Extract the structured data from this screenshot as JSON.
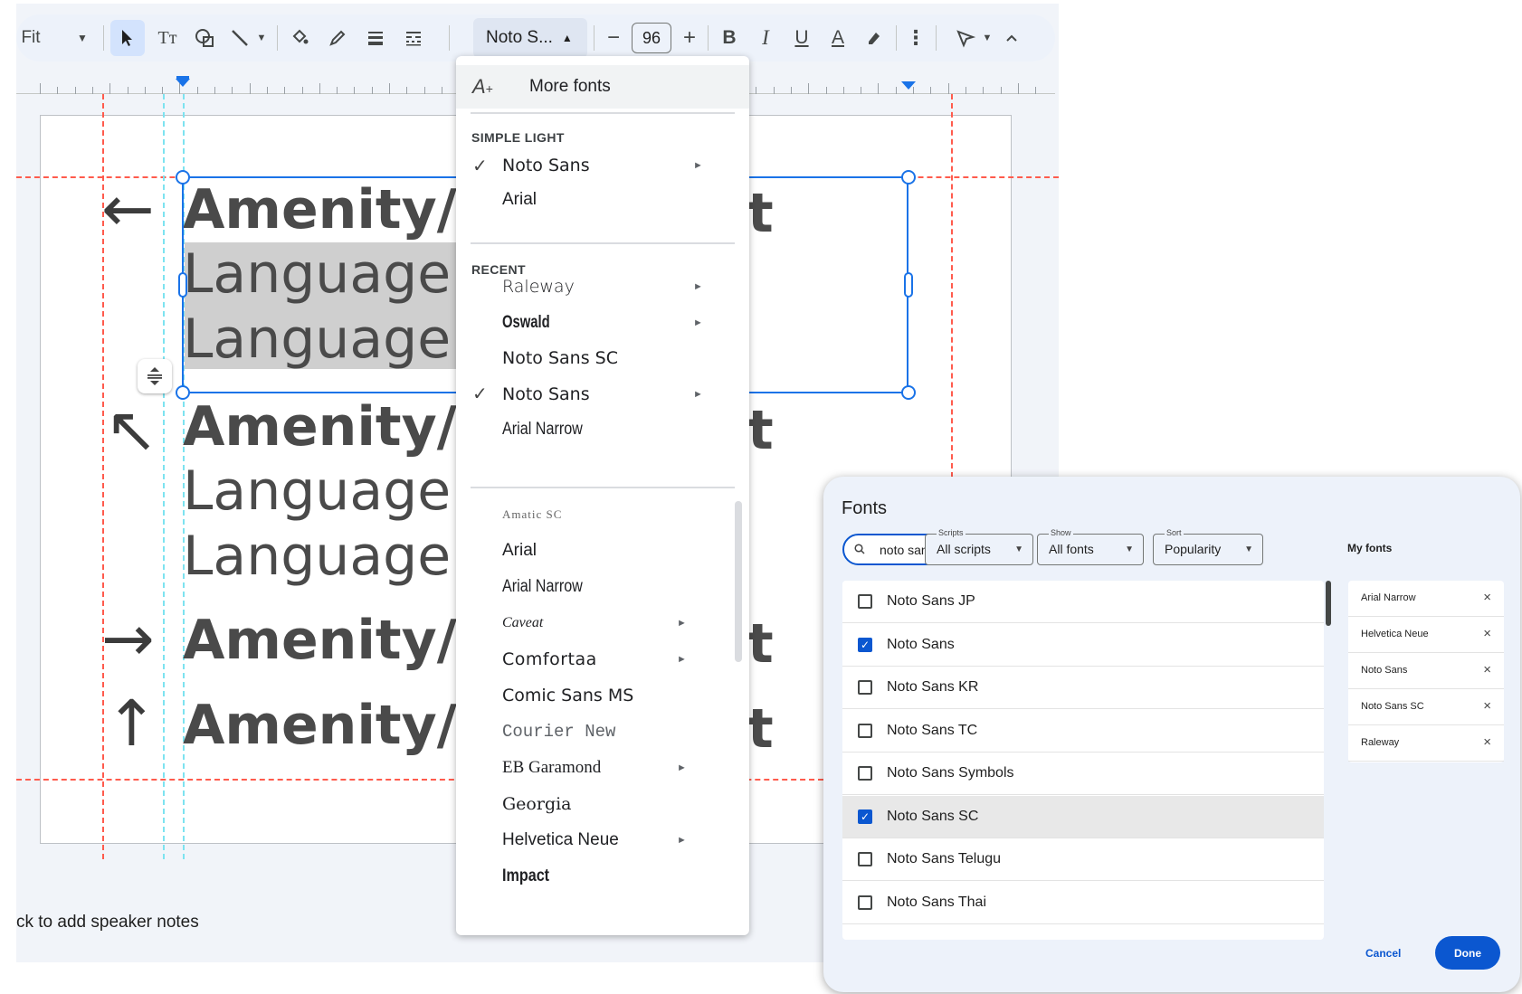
{
  "toolbar": {
    "zoom_label": "Fit",
    "font_name": "Noto S...",
    "font_size": "96",
    "icons": [
      "select-arrow-icon",
      "text-box-icon",
      "shape-icon",
      "line-icon",
      "fill-color-icon",
      "border-color-icon",
      "border-weight-icon",
      "border-dash-icon",
      "bold-icon",
      "italic-icon",
      "underline-icon",
      "text-color-icon",
      "highlight-icon",
      "more-icon",
      "pointer-icon",
      "collapse-icon"
    ],
    "bold": "B",
    "italic": "I",
    "underline": "U",
    "text_color": "A",
    "minus": "−",
    "plus": "+"
  },
  "slide": {
    "text_bold": "Amenity/D",
    "text_regular": "Language",
    "cut_char": "t"
  },
  "speaker_notes": "ck to add speaker notes",
  "font_menu": {
    "more_fonts": "More fonts",
    "section_simple": "SIMPLE LIGHT",
    "simple_items": [
      {
        "name": "Noto Sans",
        "checked": true,
        "submenu": true
      },
      {
        "name": "Arial",
        "checked": false,
        "submenu": false
      }
    ],
    "section_recent": "RECENT",
    "recent_items": [
      {
        "name": "Raleway",
        "checked": false,
        "submenu": true
      },
      {
        "name": "Oswald",
        "checked": false,
        "submenu": true
      },
      {
        "name": "Noto Sans SC",
        "checked": false,
        "submenu": false
      },
      {
        "name": "Noto Sans",
        "checked": true,
        "submenu": true
      },
      {
        "name": "Arial Narrow",
        "checked": false,
        "submenu": false
      }
    ],
    "all_items": [
      {
        "name": "Amatic SC",
        "submenu": false
      },
      {
        "name": "Arial",
        "submenu": false
      },
      {
        "name": "Arial Narrow",
        "submenu": false
      },
      {
        "name": "Caveat",
        "submenu": true
      },
      {
        "name": "Comfortaa",
        "submenu": true
      },
      {
        "name": "Comic Sans MS",
        "submenu": false
      },
      {
        "name": "Courier New",
        "submenu": false
      },
      {
        "name": "EB Garamond",
        "submenu": true
      },
      {
        "name": "Georgia",
        "submenu": false
      },
      {
        "name": "Helvetica Neue",
        "submenu": true
      },
      {
        "name": "Impact",
        "submenu": false
      }
    ],
    "check_glyph": "✓",
    "submenu_glyph": "►"
  },
  "fonts_dialog": {
    "title": "Fonts",
    "search_value": "noto sans",
    "filters": [
      {
        "label": "Scripts",
        "value": "All scripts"
      },
      {
        "label": "Show",
        "value": "All fonts"
      },
      {
        "label": "Sort",
        "value": "Popularity"
      }
    ],
    "my_fonts_label": "My fonts",
    "results": [
      {
        "name": "Noto Sans JP",
        "checked": false
      },
      {
        "name": "Noto Sans",
        "checked": true
      },
      {
        "name": "Noto Sans KR",
        "checked": false
      },
      {
        "name": "Noto Sans TC",
        "checked": false
      },
      {
        "name": "Noto Sans Symbols",
        "checked": false
      },
      {
        "name": "Noto Sans SC",
        "checked": true
      },
      {
        "name": "Noto Sans Telugu",
        "checked": false
      },
      {
        "name": "Noto Sans Thai",
        "checked": false
      }
    ],
    "my_fonts": [
      "Arial Narrow",
      "Helvetica Neue",
      "Noto Sans",
      "Noto Sans SC",
      "Raleway"
    ],
    "cancel_label": "Cancel",
    "done_label": "Done"
  },
  "colors": {
    "accent": "#1a73e8",
    "guide": "#ff5b4d",
    "center_guide": "#7de3f0",
    "dialog_primary": "#0b57d0"
  }
}
